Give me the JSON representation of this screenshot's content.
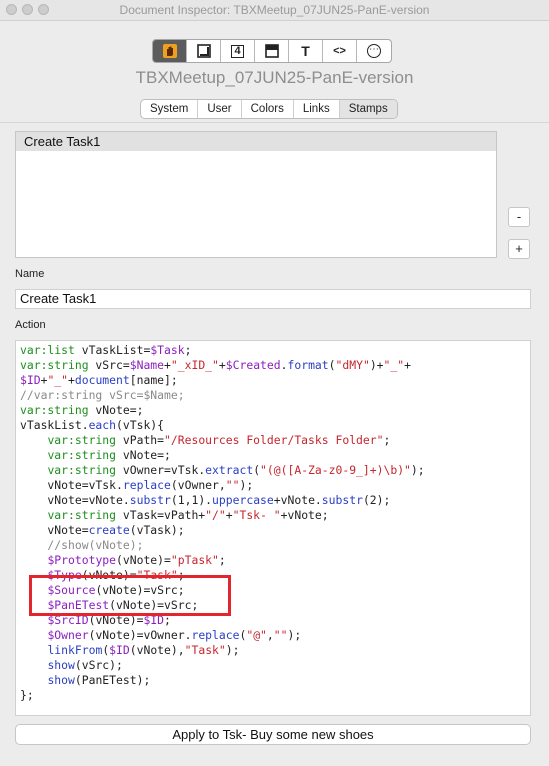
{
  "window": {
    "title": "Document Inspector: TBXMeetup_07JUN25-PanE-version"
  },
  "toolbar": {
    "buttons": [
      {
        "icon": "hand-stamp-icon"
      },
      {
        "icon": "note-icon"
      },
      {
        "icon": "number-4-icon",
        "text": "4"
      },
      {
        "icon": "window-icon"
      },
      {
        "icon": "text-icon",
        "text": "T"
      },
      {
        "icon": "code-icon",
        "text": "<>"
      },
      {
        "icon": "more-icon",
        "text": "⋯"
      }
    ]
  },
  "document_title": "TBXMeetup_07JUN25-PanE-version",
  "tabs": [
    {
      "label": "System"
    },
    {
      "label": "User"
    },
    {
      "label": "Colors"
    },
    {
      "label": "Links"
    },
    {
      "label": "Stamps",
      "selected": true
    }
  ],
  "stamps": {
    "items": [
      "Create Task1"
    ]
  },
  "buttons": {
    "remove": "-",
    "add": "+"
  },
  "name_label": "Name",
  "name_value": "Create Task1",
  "action_label": "Action",
  "code_lines": [
    "var:list vTaskList=$Task;",
    "var:string vSrc=$Name+\"_xID_\"+$Created.format(\"dMY\")+\"_\"+",
    "$ID+\"_\"+document[name];",
    "//var:string vSrc=$Name;",
    "var:string vNote=;",
    "vTaskList.each(vTsk){",
    "    var:string vPath=\"/Resources Folder/Tasks Folder\";",
    "    var:string vNote=;",
    "    var:string vOwner=vTsk.extract(\"(@([A-Za-z0-9_]+)\\b)\");",
    "    vNote=vTsk.replace(vOwner,\"\");",
    "    vNote=vNote.substr(1,1).uppercase+vNote.substr(2);",
    "    var:string vTask=vPath+\"/\"+\"Tsk- \"+vNote;",
    "    vNote=create(vTask);",
    "    //show(vNote);",
    "    $Prototype(vNote)=\"pTask\";",
    "    $Type(vNote)=\"Task\";",
    "    $Source(vNote)=vSrc;",
    "    $PanETest(vNote)=vSrc;",
    "    $SrcID(vNote)=$ID;",
    "    $Owner(vNote)=vOwner.replace(\"@\",\"\");",
    "    linkFrom($ID(vNote),\"Task\");",
    "    show(vSrc);",
    "    show(PanETest);",
    "};"
  ],
  "apply_button": "Apply to Tsk- Buy some new shoes",
  "colors": {
    "keyword": "#1e8f1e",
    "attribute": "#8b1fbe",
    "function": "#2a3fc4",
    "string": "#c6262e",
    "comment": "#8a8a8a",
    "highlight": "#e3262d"
  }
}
